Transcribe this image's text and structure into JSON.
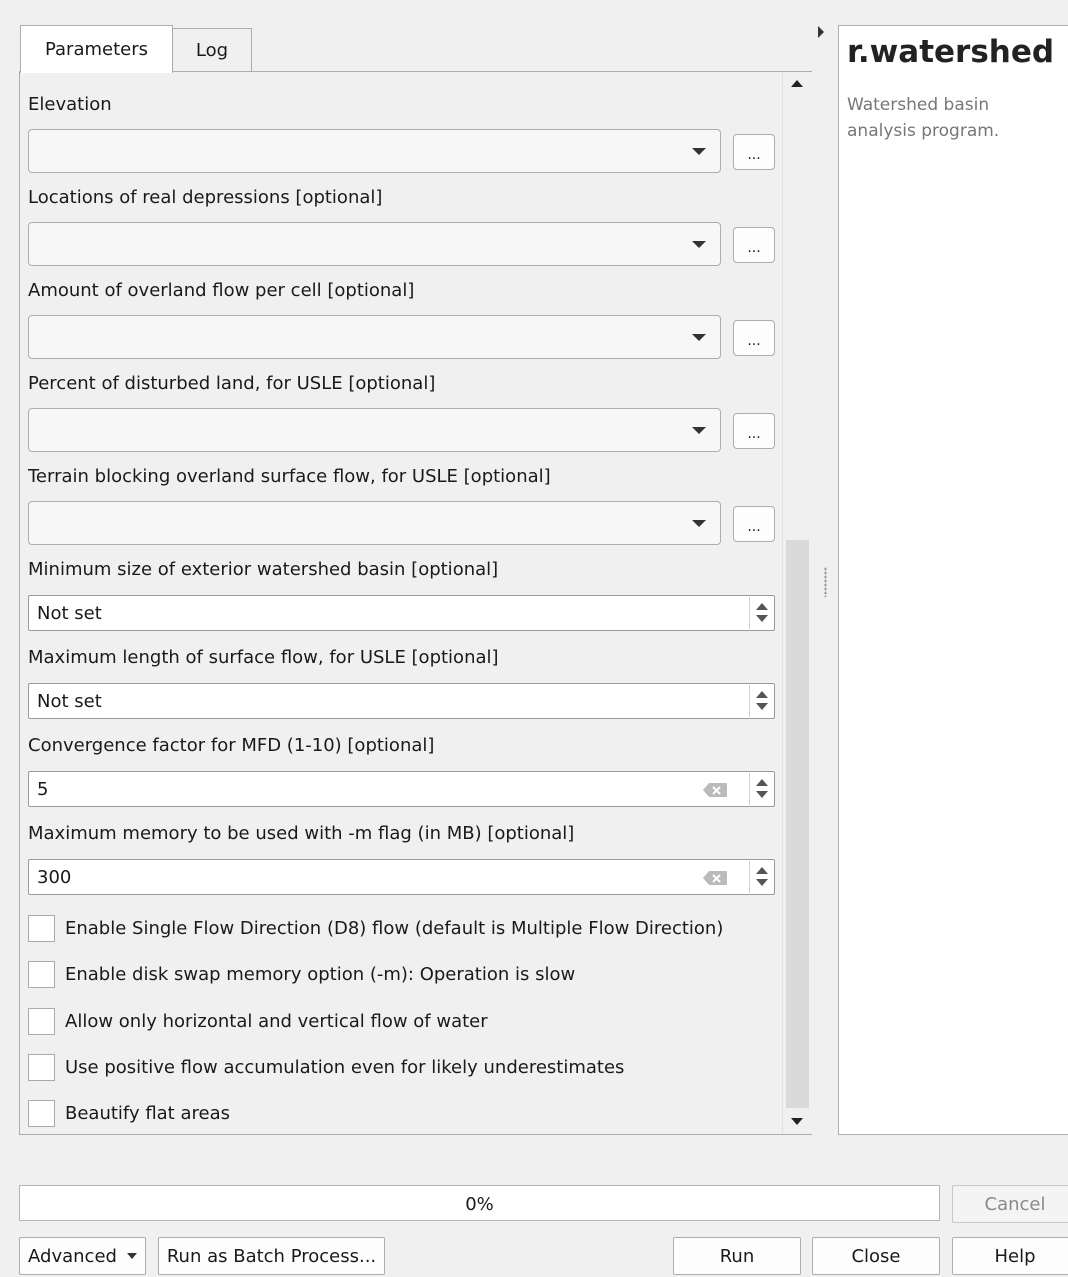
{
  "tabs": [
    {
      "label": "Parameters",
      "active": true
    },
    {
      "label": "Log",
      "active": false
    }
  ],
  "parameters": {
    "combos": [
      {
        "label": "Elevation",
        "value": ""
      },
      {
        "label": "Locations of real depressions [optional]",
        "value": ""
      },
      {
        "label": "Amount of overland flow per cell [optional]",
        "value": ""
      },
      {
        "label": "Percent of disturbed land, for USLE [optional]",
        "value": ""
      },
      {
        "label": "Terrain blocking overland surface flow, for USLE [optional]",
        "value": ""
      }
    ],
    "browse_label": "...",
    "spins": [
      {
        "label": "Minimum size of exterior watershed basin [optional]",
        "value": "Not set"
      },
      {
        "label": "Maximum length of surface flow, for USLE [optional]",
        "value": "Not set"
      },
      {
        "label": "Convergence factor for MFD (1-10) [optional]",
        "value": "5"
      },
      {
        "label": "Maximum memory to be used with -m flag (in MB) [optional]",
        "value": "300"
      }
    ],
    "checkboxes": [
      {
        "label": "Enable Single Flow Direction (D8) flow (default is Multiple Flow Direction)",
        "checked": false
      },
      {
        "label": "Enable disk swap memory option (-m): Operation is slow",
        "checked": false
      },
      {
        "label": "Allow only horizontal and vertical flow of water",
        "checked": false
      },
      {
        "label": "Use positive flow accumulation even for likely underestimates",
        "checked": false
      },
      {
        "label": "Beautify flat areas",
        "checked": false
      }
    ]
  },
  "help": {
    "title": "r.watershed",
    "description": "Watershed basin analysis program."
  },
  "progress": {
    "text": "0%",
    "fraction": 0.0
  },
  "buttons": {
    "cancel": "Cancel",
    "advanced": "Advanced",
    "batch": "Run as Batch Process...",
    "run": "Run",
    "close": "Close",
    "help": "Help"
  },
  "icons": {
    "dropdown": "chevron-down-icon",
    "clear": "backspace-clear-icon",
    "spin": "spin-arrows-icon",
    "splitter": "triangle-right-icon"
  }
}
